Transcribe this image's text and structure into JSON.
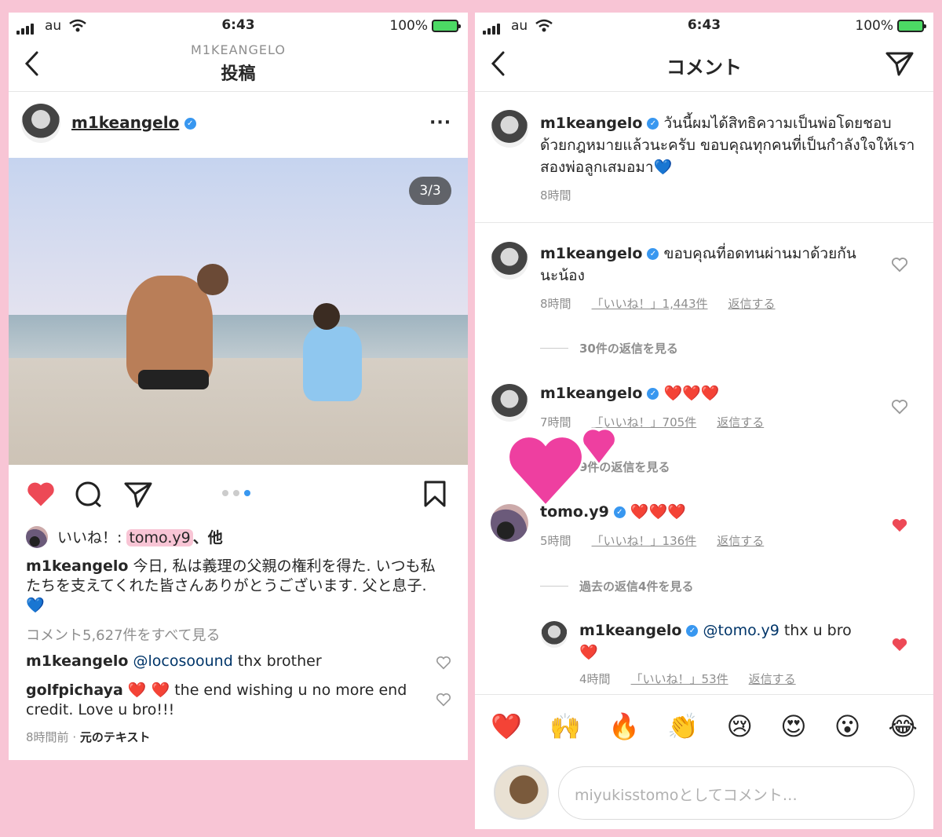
{
  "status": {
    "carrier": "au",
    "time": "6:43",
    "battery": "100%"
  },
  "left": {
    "header": {
      "account": "M1KEANGELO",
      "title": "投稿"
    },
    "post_user": "m1keangelo",
    "counter": "3/3",
    "likes": {
      "prefix": "いいね！: ",
      "user": "tomo.y9",
      "suffix": "、他"
    },
    "caption": {
      "user": "m1keangelo",
      "text": " 今日, 私は義理の父親の権利を得た. いつも私たちを支えてくれた皆さんありがとうございます. 父と息子. 💙"
    },
    "view_all": "コメント5,627件をすべて見る",
    "comments": [
      {
        "user": "m1keangelo",
        "mention": "@locosoound",
        "text": " thx brother"
      },
      {
        "user": "golfpichaya",
        "text": " ❤️ ❤️  the end wishing u no more end credit. Love u bro!!!"
      }
    ],
    "time": "8時間前",
    "see_original": "元のテキスト"
  },
  "right": {
    "title": "コメント",
    "caption": {
      "user": "m1keangelo",
      "text": " วันนี้ผมได้สิทธิความเป็นพ่อโดยชอบด้วยกฎหมายแล้วนะครับ ขอบคุณทุกคนที่เป็นกำลังใจให้เราสองพ่อลูกเสมอมา💙",
      "time": "8時間"
    },
    "comments": [
      {
        "user": "m1keangelo",
        "text": " ขอบคุณที่อดทนผ่านมาด้วยกันนะน้อง",
        "time": "8時間",
        "likes": "「いいね！」1,443件",
        "reply": "返信する",
        "view_replies": "30件の返信を見る"
      },
      {
        "user": "m1keangelo",
        "text": " ❤️❤️❤️",
        "time": "7時間",
        "likes": "「いいね！」705件",
        "reply": "返信する",
        "view_replies": "9件の返信を見る"
      },
      {
        "user": "tomo.y9",
        "text": " ❤️❤️❤️",
        "time": "5時間",
        "likes": "「いいね！」136件",
        "reply": "返信する",
        "view_replies": "過去の返信4件を見る"
      }
    ],
    "reply": {
      "user": "m1keangelo",
      "mention": "@tomo.y9",
      "text": " thx u bro",
      "emoji": "❤️",
      "time": "4時間",
      "likes": "「いいね！」53件",
      "reply": "返信する"
    },
    "emoji_bar": [
      "❤️",
      "🙌",
      "🔥",
      "👏",
      "😢",
      "😍",
      "😮",
      "😂"
    ],
    "input_placeholder": "miyukisstomoとしてコメント…"
  }
}
